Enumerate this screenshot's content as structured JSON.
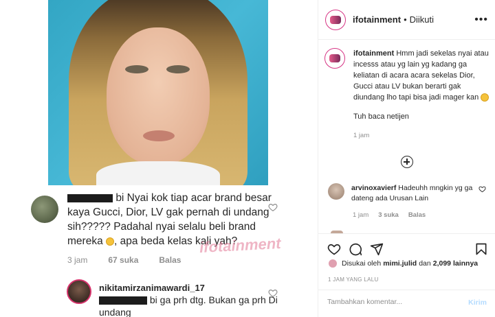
{
  "post": {
    "account": "ifotainment",
    "follow_state": "Diikuti",
    "caption": "Hmm jadi sekelas nyai atau incesss atau yg lain yg kadang ga keliatan di acara acara sekelas Dior, Gucci atau LV bukan berarti gak diundang lho tapi bisa jadi mager kan",
    "caption_extra": "Tuh baca netijen",
    "caption_time": "1 jam",
    "liked_by_prefix": "Disukai oleh",
    "liked_by_user": "mimi.julid",
    "liked_by_and": "dan",
    "like_count": "2,099 lainnya",
    "posted_ago": "1 JAM YANG LALU",
    "comment_placeholder": "Tambahkan komentar...",
    "post_button": "Kirim"
  },
  "comments": [
    {
      "user": "arvinoxavierf",
      "text": "Hadeuhh mngkin yg ga dateng ada Urusan Lain",
      "time": "1 jam",
      "likes": "3 suka",
      "reply": "Balas"
    }
  ],
  "screenshot": {
    "comment_text_pre": "bi Nyai kok tiap acar brand besar kaya Gucci, Dior, LV gak pernah di undang sih????? Padahal nyai selalu beli brand mereka",
    "comment_text_post": ", apa beda kelas kali yah?",
    "time": "3 jam",
    "likes": "67 suka",
    "reply": "Balas",
    "reply_user": "nikitamirzanimawardi_17",
    "reply_text": "bi ga prh dtg. Bukan ga prh Di undang",
    "watermark": "ifotainment"
  },
  "colors": {
    "photo_bg": "#3aaecb",
    "link_blue": "#b3dbff",
    "muted": "#8e8e8e",
    "story_ring": "#d63384"
  },
  "icons": [
    "heart-icon",
    "comment-icon",
    "share-icon",
    "save-icon",
    "more-icon",
    "add-comments-icon",
    "emoji-icon"
  ]
}
